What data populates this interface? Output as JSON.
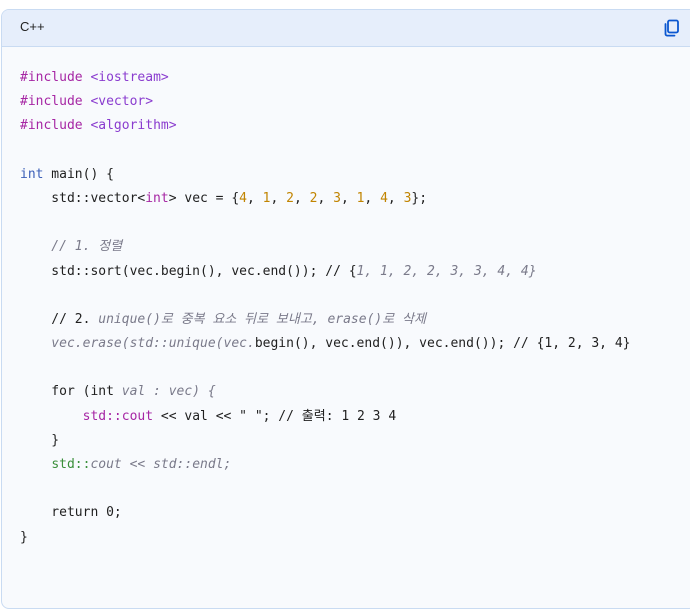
{
  "header": {
    "language": "C++",
    "copy_icon": "copy-icon"
  },
  "code": {
    "l1_kw": "#include",
    "l1_hdr": "<iostream>",
    "l2_kw": "#include",
    "l2_hdr": "<vector>",
    "l3_kw": "#include",
    "l3_hdr": "<algorithm>",
    "l5_type": "int",
    "l5_rest": " main() {",
    "l6_a": "    std::vector<",
    "l6_type": "int",
    "l6_b": "> vec = {",
    "l6_n1": "4",
    "l6_n2": "1",
    "l6_n3": "2",
    "l6_n4": "2",
    "l6_n5": "3",
    "l6_n6": "1",
    "l6_n7": "4",
    "l6_n8": "3",
    "l6_end": "};",
    "l8_cmt": "    // 1. 정렬",
    "l9_a": "    std::sort(vec.begin(), vec.end()); // {",
    "l9_cmt": "1, 1, 2, 2, 3, 3, 4, 4}",
    "l11_a": "    // 2. ",
    "l11_cmt": "unique()로 중복 요소 뒤로 보내고, erase()로 삭제",
    "l12_cmt": "    vec.erase(std::unique(vec.",
    "l12_b": "begin(), vec.end()), vec.end()); // {1, 2, 3, 4}",
    "l14_a": "    for (int ",
    "l14_cmt": "val : vec) {",
    "l15_ind": "        ",
    "l15_cout": "std::cout",
    "l15_b": " << val << \" \"; // 출력: 1 2 3 4",
    "l16": "    }",
    "l17_ind": "    ",
    "l17_std": "std::",
    "l17_cmt": "cout << std::endl;",
    "l19": "    return 0;",
    "l20": "}"
  }
}
